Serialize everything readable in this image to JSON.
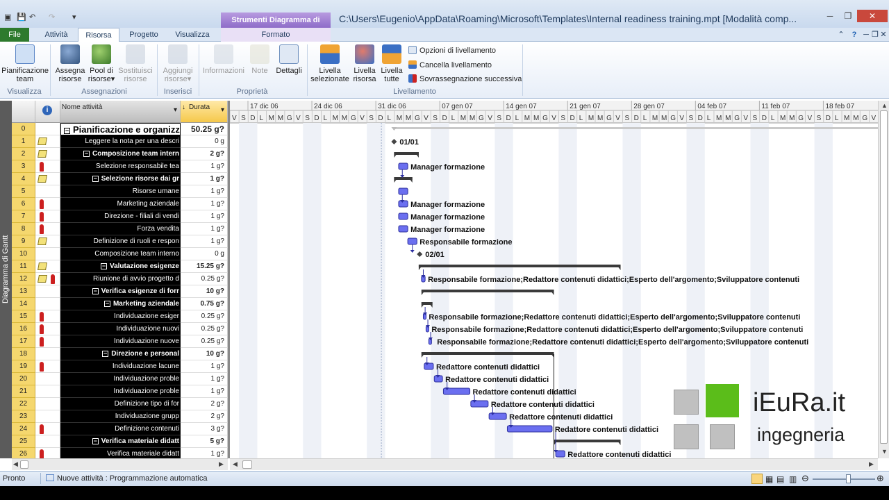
{
  "window": {
    "title": "C:\\Users\\Eugenio\\AppData\\Roaming\\Microsoft\\Templates\\Internal readiness training.mpt [Modalità comp...",
    "context_tab_group": "Strumenti Diagramma di Gantt"
  },
  "tabs": [
    {
      "label": "File"
    },
    {
      "label": "Attività"
    },
    {
      "label": "Risorsa"
    },
    {
      "label": "Progetto"
    },
    {
      "label": "Visualizza"
    },
    {
      "label": "Formato"
    }
  ],
  "ribbon": {
    "groups": {
      "visualizza": "Visualizza",
      "assegnazioni": "Assegnazioni",
      "inserisci": "Inserisci",
      "proprieta": "Proprietà",
      "livellamento": "Livellamento"
    },
    "buttons": {
      "pianificazione_team_1": "Pianificazione",
      "pianificazione_team_2": "team",
      "assegna_risorse_1": "Assegna",
      "assegna_risorse_2": "risorse",
      "pool_risorse_1": "Pool di",
      "pool_risorse_2": "risorse",
      "sostituisci_risorse_1": "Sostituisci",
      "sostituisci_risorse_2": "risorse",
      "aggiungi_risorse_1": "Aggiungi",
      "aggiungi_risorse_2": "risorse",
      "informazioni": "Informazioni",
      "note": "Note",
      "dettagli": "Dettagli",
      "livella_selezionate_1": "Livella",
      "livella_selezionate_2": "selezionate",
      "livella_risorsa_1": "Livella",
      "livella_risorsa_2": "risorsa",
      "livella_tutte_1": "Livella",
      "livella_tutte_2": "tutte",
      "opzioni_livellamento": "Opzioni di livellamento",
      "cancella_livellamento": "Cancella livellamento",
      "sovrassegnazione": "Sovrassegnazione successiva"
    }
  },
  "view_label": "Diagramma di Gantt",
  "columns": {
    "name": "Nome attività",
    "duration": "Durata"
  },
  "tasks": [
    {
      "id": "0",
      "name": "Pianificazione e organizz",
      "duration": "50.25 g?",
      "summary": true,
      "note": false,
      "res": false
    },
    {
      "id": "1",
      "name": "Leggere la nota per una descri",
      "duration": "0 g",
      "summary": false,
      "note": true,
      "res": false
    },
    {
      "id": "2",
      "name": "Composizione team intern",
      "duration": "2 g?",
      "summary": true,
      "note": true,
      "res": false
    },
    {
      "id": "3",
      "name": "Selezione responsabile tea",
      "duration": "1 g?",
      "summary": false,
      "note": false,
      "res": true
    },
    {
      "id": "4",
      "name": "Selezione risorse dai gr",
      "duration": "1 g?",
      "summary": true,
      "note": true,
      "res": false
    },
    {
      "id": "5",
      "name": "Risorse umane",
      "duration": "1 g?",
      "summary": false,
      "note": false,
      "res": false
    },
    {
      "id": "6",
      "name": "Marketing aziendale",
      "duration": "1 g?",
      "summary": false,
      "note": false,
      "res": true
    },
    {
      "id": "7",
      "name": "Direzione - filiali di vendi",
      "duration": "1 g?",
      "summary": false,
      "note": false,
      "res": true
    },
    {
      "id": "8",
      "name": "Forza vendita",
      "duration": "1 g?",
      "summary": false,
      "note": false,
      "res": true
    },
    {
      "id": "9",
      "name": "Definizione di ruoli e respon",
      "duration": "1 g?",
      "summary": false,
      "note": true,
      "res": false
    },
    {
      "id": "10",
      "name": "Composizione team interno",
      "duration": "0 g",
      "summary": false,
      "note": false,
      "res": false
    },
    {
      "id": "11",
      "name": "Valutazione esigenze",
      "duration": "15.25 g?",
      "summary": true,
      "note": true,
      "res": false
    },
    {
      "id": "12",
      "name": "Riunione di avvio progetto d",
      "duration": "0.25 g?",
      "summary": false,
      "note": true,
      "res": true
    },
    {
      "id": "13",
      "name": "Verifica esigenze di forr",
      "duration": "10 g?",
      "summary": true,
      "note": false,
      "res": false
    },
    {
      "id": "14",
      "name": "Marketing aziendale",
      "duration": "0.75 g?",
      "summary": true,
      "note": false,
      "res": false
    },
    {
      "id": "15",
      "name": "Individuazione esiger",
      "duration": "0.25 g?",
      "summary": false,
      "note": false,
      "res": true
    },
    {
      "id": "16",
      "name": "Individuazione nuovi",
      "duration": "0.25 g?",
      "summary": false,
      "note": false,
      "res": true
    },
    {
      "id": "17",
      "name": "Individuazione nuove",
      "duration": "0.25 g?",
      "summary": false,
      "note": false,
      "res": true
    },
    {
      "id": "18",
      "name": "Direzione e personal",
      "duration": "10 g?",
      "summary": true,
      "note": false,
      "res": false
    },
    {
      "id": "19",
      "name": "Individuazione lacune",
      "duration": "1 g?",
      "summary": false,
      "note": false,
      "res": true
    },
    {
      "id": "20",
      "name": "Individuazione proble",
      "duration": "1 g?",
      "summary": false,
      "note": false,
      "res": false
    },
    {
      "id": "21",
      "name": "Individuazione proble",
      "duration": "1 g?",
      "summary": false,
      "note": false,
      "res": false
    },
    {
      "id": "22",
      "name": "Definizione tipo di for",
      "duration": "2 g?",
      "summary": false,
      "note": false,
      "res": false
    },
    {
      "id": "23",
      "name": "Individuazione grupp",
      "duration": "2 g?",
      "summary": false,
      "note": false,
      "res": false
    },
    {
      "id": "24",
      "name": "Definizione contenuti",
      "duration": "3 g?",
      "summary": false,
      "note": false,
      "res": true
    },
    {
      "id": "25",
      "name": "Verifica materiale didatt",
      "duration": "5 g?",
      "summary": true,
      "note": false,
      "res": false
    },
    {
      "id": "26",
      "name": "Verifica materiale didatt",
      "duration": "1 g?",
      "summary": false,
      "note": false,
      "res": true
    }
  ],
  "timescale": {
    "weeks": [
      "17 dic 06",
      "24 dic 06",
      "31 dic 06",
      "07 gen 07",
      "14 gen 07",
      "21 gen 07",
      "28 gen 07",
      "04 feb 07",
      "11 feb 07",
      "18 feb 07"
    ],
    "days": [
      "V",
      "S",
      "D",
      "L",
      "M",
      "M",
      "G"
    ]
  },
  "gantt_labels": {
    "milestone_1": "01/01",
    "milestone_2": "02/01",
    "manager": "Manager formazione",
    "responsabile": "Responsabile formazione",
    "team": "Responsabile formazione;Redattore contenuti didattici;Esperto dell'argomento;Sviluppatore contenuti",
    "redattore": "Redattore contenuti didattici"
  },
  "statusbar": {
    "ready": "Pronto",
    "new_tasks": "Nuove attività : Programmazione automatica"
  },
  "logo": {
    "title": "iEuRa.it",
    "subtitle": "ingegneria"
  },
  "colors": {
    "task_bar": "#6b6ff0",
    "summary_bar": "#3a3a3a",
    "ribbon_file": "#2d7a2d",
    "id_column": "#f5d76e"
  }
}
